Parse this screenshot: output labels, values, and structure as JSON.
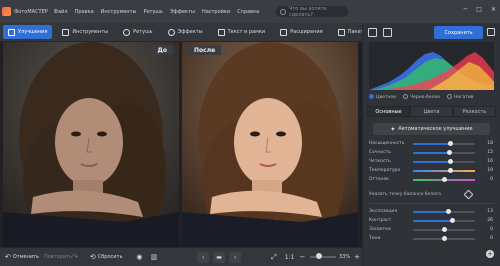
{
  "app": {
    "name": "ФотоМАСТЕР"
  },
  "menu": [
    "Файл",
    "Правка",
    "Инструменты",
    "Ретушь",
    "Эффекты",
    "Настройки",
    "Справка"
  ],
  "search": {
    "placeholder": "Что вы хотите сделать?"
  },
  "toolbar": [
    {
      "label": "Улучшения",
      "active": true
    },
    {
      "label": "Инструменты",
      "active": false
    },
    {
      "label": "Ретушь",
      "active": false
    },
    {
      "label": "Эффекты",
      "active": false
    },
    {
      "label": "Текст и рамки",
      "active": false
    },
    {
      "label": "Расширения",
      "active": false
    },
    {
      "label": "Пакетная обработка",
      "active": false
    }
  ],
  "compare": {
    "before_label": "До",
    "after_label": "После"
  },
  "bottombar": {
    "undo_label": "Отменить",
    "redo_label": "Повторить",
    "reset_label": "Сбросить",
    "ratio_label": "1:1",
    "zoom_label": "33%"
  },
  "right_panel": {
    "save_label": "Сохранить",
    "histogram_modes": [
      "Цветное",
      "Черно-белое",
      "Негатив"
    ],
    "tabs": [
      "Основные",
      "Цвета",
      "Резкость"
    ],
    "auto_label": "Автоматическое улучшение",
    "wb_label": "Указать точку баланса белого",
    "sliders_top": [
      {
        "label": "Насыщенность",
        "value": "18"
      },
      {
        "label": "Сочность",
        "value": "15"
      },
      {
        "label": "Четкость",
        "value": "16"
      },
      {
        "label": "Температура",
        "value": "19"
      },
      {
        "label": "Оттенок",
        "value": "0"
      }
    ],
    "sliders_bottom": [
      {
        "label": "Экспозиция",
        "value": "13"
      },
      {
        "label": "Контраст",
        "value": "26"
      },
      {
        "label": "Засветки",
        "value": "0"
      },
      {
        "label": "Тени",
        "value": "0"
      }
    ]
  },
  "colors": {
    "accent": "#2f6fd6",
    "panel": "#2f3237",
    "titlebar": "#3a3d42"
  }
}
